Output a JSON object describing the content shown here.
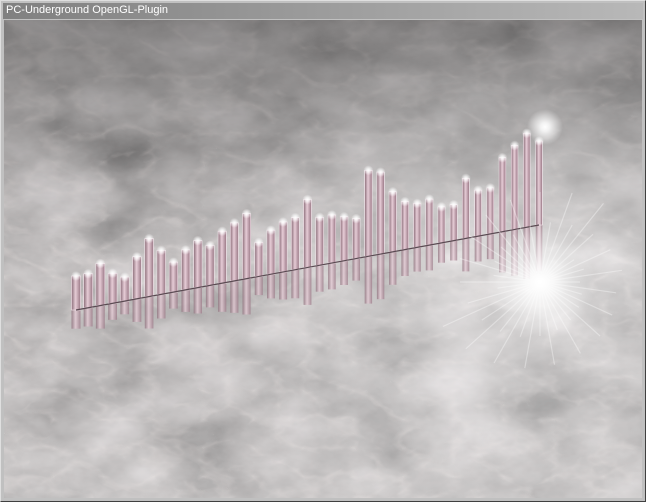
{
  "window": {
    "title": "PC-Underground OpenGL-Plugin"
  },
  "visualizer": {
    "bars": [
      34,
      34,
      42,
      30,
      24,
      42,
      58,
      44,
      30,
      40,
      47,
      40,
      52,
      58,
      65,
      34,
      44,
      50,
      52,
      68,
      48,
      48,
      44,
      40,
      86,
      82,
      60,
      48,
      44,
      46,
      36,
      36,
      60,
      46,
      46,
      74,
      84,
      94,
      84
    ]
  },
  "colors": {
    "bar": "#c8a8b4",
    "bar_edge": "#f4e4ec",
    "glow": "#ffffff"
  }
}
